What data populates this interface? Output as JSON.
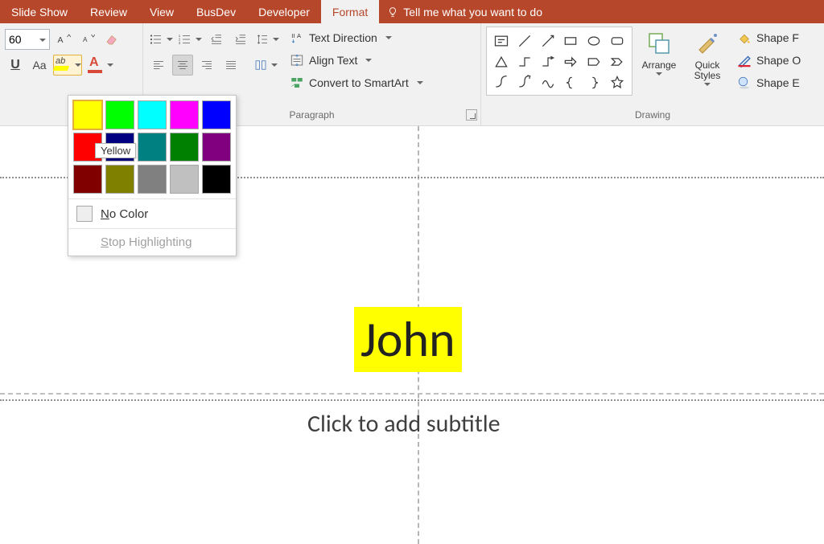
{
  "tabs": {
    "slide_show": "Slide Show",
    "review": "Review",
    "view": "View",
    "busdev": "BusDev",
    "developer": "Developer",
    "format": "Format",
    "tell_me": "Tell me what you want to do"
  },
  "font": {
    "size": "60",
    "change_case": "Aa"
  },
  "paragraph": {
    "group_label": "Paragraph",
    "text_direction": "Text Direction",
    "align_text": "Align Text",
    "convert_smartart": "Convert to SmartArt"
  },
  "drawing": {
    "group_label": "Drawing",
    "arrange": "Arrange",
    "quick_styles": "Quick Styles",
    "shape_fill": "Shape F",
    "shape_outline": "Shape O",
    "shape_effects": "Shape E"
  },
  "highlight_popup": {
    "tooltip": "Yellow",
    "no_color": "No Color",
    "stop": "Stop Highlighting",
    "colors": [
      {
        "name": "yellow",
        "hex": "#ffff00",
        "selected": true
      },
      {
        "name": "bright-green",
        "hex": "#00ff00"
      },
      {
        "name": "turquoise",
        "hex": "#00ffff"
      },
      {
        "name": "pink",
        "hex": "#ff00ff"
      },
      {
        "name": "blue",
        "hex": "#0000ff"
      },
      {
        "name": "red",
        "hex": "#ff0000"
      },
      {
        "name": "dark-blue",
        "hex": "#000080"
      },
      {
        "name": "teal",
        "hex": "#008080"
      },
      {
        "name": "green",
        "hex": "#008000"
      },
      {
        "name": "violet",
        "hex": "#800080"
      },
      {
        "name": "dark-red",
        "hex": "#800000"
      },
      {
        "name": "dark-yellow",
        "hex": "#808000"
      },
      {
        "name": "gray-50",
        "hex": "#808080"
      },
      {
        "name": "gray-25",
        "hex": "#c0c0c0"
      },
      {
        "name": "black",
        "hex": "#000000"
      }
    ]
  },
  "slide": {
    "title": "John",
    "subtitle_placeholder": "Click to add subtitle"
  }
}
